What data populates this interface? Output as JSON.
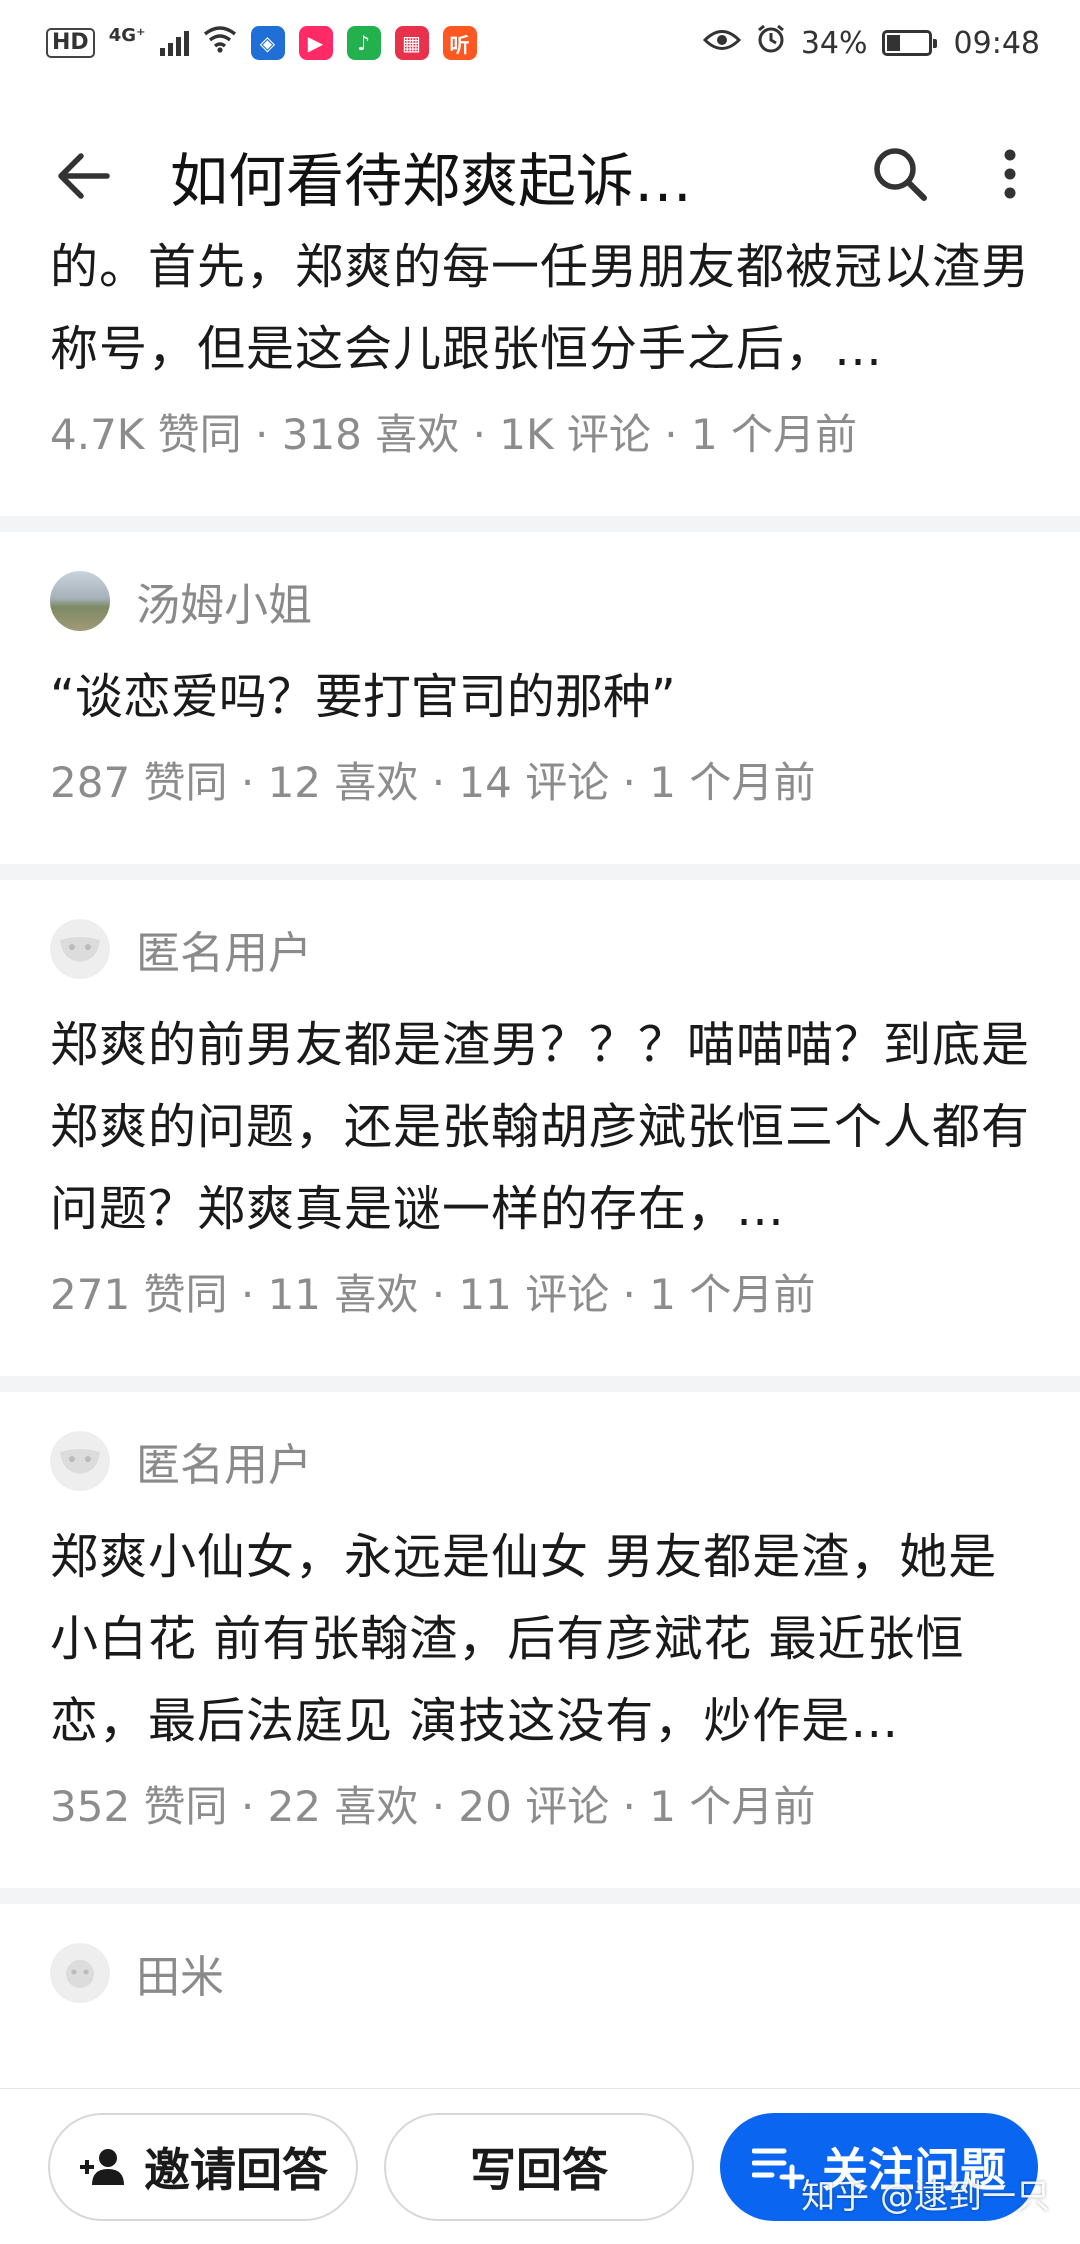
{
  "status_bar": {
    "hd": "HD",
    "network": "4G⁺",
    "battery": "34%",
    "time": "09:48",
    "app_icons": [
      {
        "name": "security-app-icon",
        "color": "#1f6fd6",
        "glyph": "◈"
      },
      {
        "name": "youku-app-icon",
        "color": "#ff2a66",
        "glyph": "▶"
      },
      {
        "name": "cloud-music-app-icon",
        "color": "#23b14d",
        "glyph": "♪"
      },
      {
        "name": "calendar-app-icon",
        "color": "#e8324b",
        "glyph": "▦"
      },
      {
        "name": "ting-app-icon",
        "color": "#ff5722",
        "glyph": "听"
      }
    ]
  },
  "header": {
    "title": "如何看待郑爽起诉…"
  },
  "answers": [
    {
      "author": "",
      "text": "的。首先，郑爽的每一任男朋友都被冠以渣男称号，但是这会儿跟张恒分手之后，…",
      "stats": "4.7K 赞同 · 318 喜欢 · 1K 评论 · 1 个月前"
    },
    {
      "author": "汤姆小姐",
      "text": "“谈恋爱吗？要打官司的那种”",
      "stats": "287 赞同 · 12 喜欢 · 14 评论 · 1 个月前"
    },
    {
      "author": "匿名用户",
      "text": "郑爽的前男友都是渣男？？？喵喵喵？到底是郑爽的问题，还是张翰胡彦斌张恒三个人都有问题？郑爽真是谜一样的存在，…",
      "stats": "271 赞同 · 11 喜欢 · 11 评论 · 1 个月前"
    },
    {
      "author": "匿名用户",
      "text": "郑爽小仙女，永远是仙女 男友都是渣，她是小白花 前有张翰渣，后有彦斌花 最近张恒恋，最后法庭见 演技这没有，炒作是…",
      "stats": "352 赞同 · 22 喜欢 · 20 评论 · 1 个月前"
    },
    {
      "author": "田米"
    }
  ],
  "bottom_bar": {
    "invite_label": "邀请回答",
    "write_label": "写回答",
    "follow_label": "关注问题",
    "accent_color": "#0a66f0"
  },
  "watermark": "知乎 @逮到一只"
}
